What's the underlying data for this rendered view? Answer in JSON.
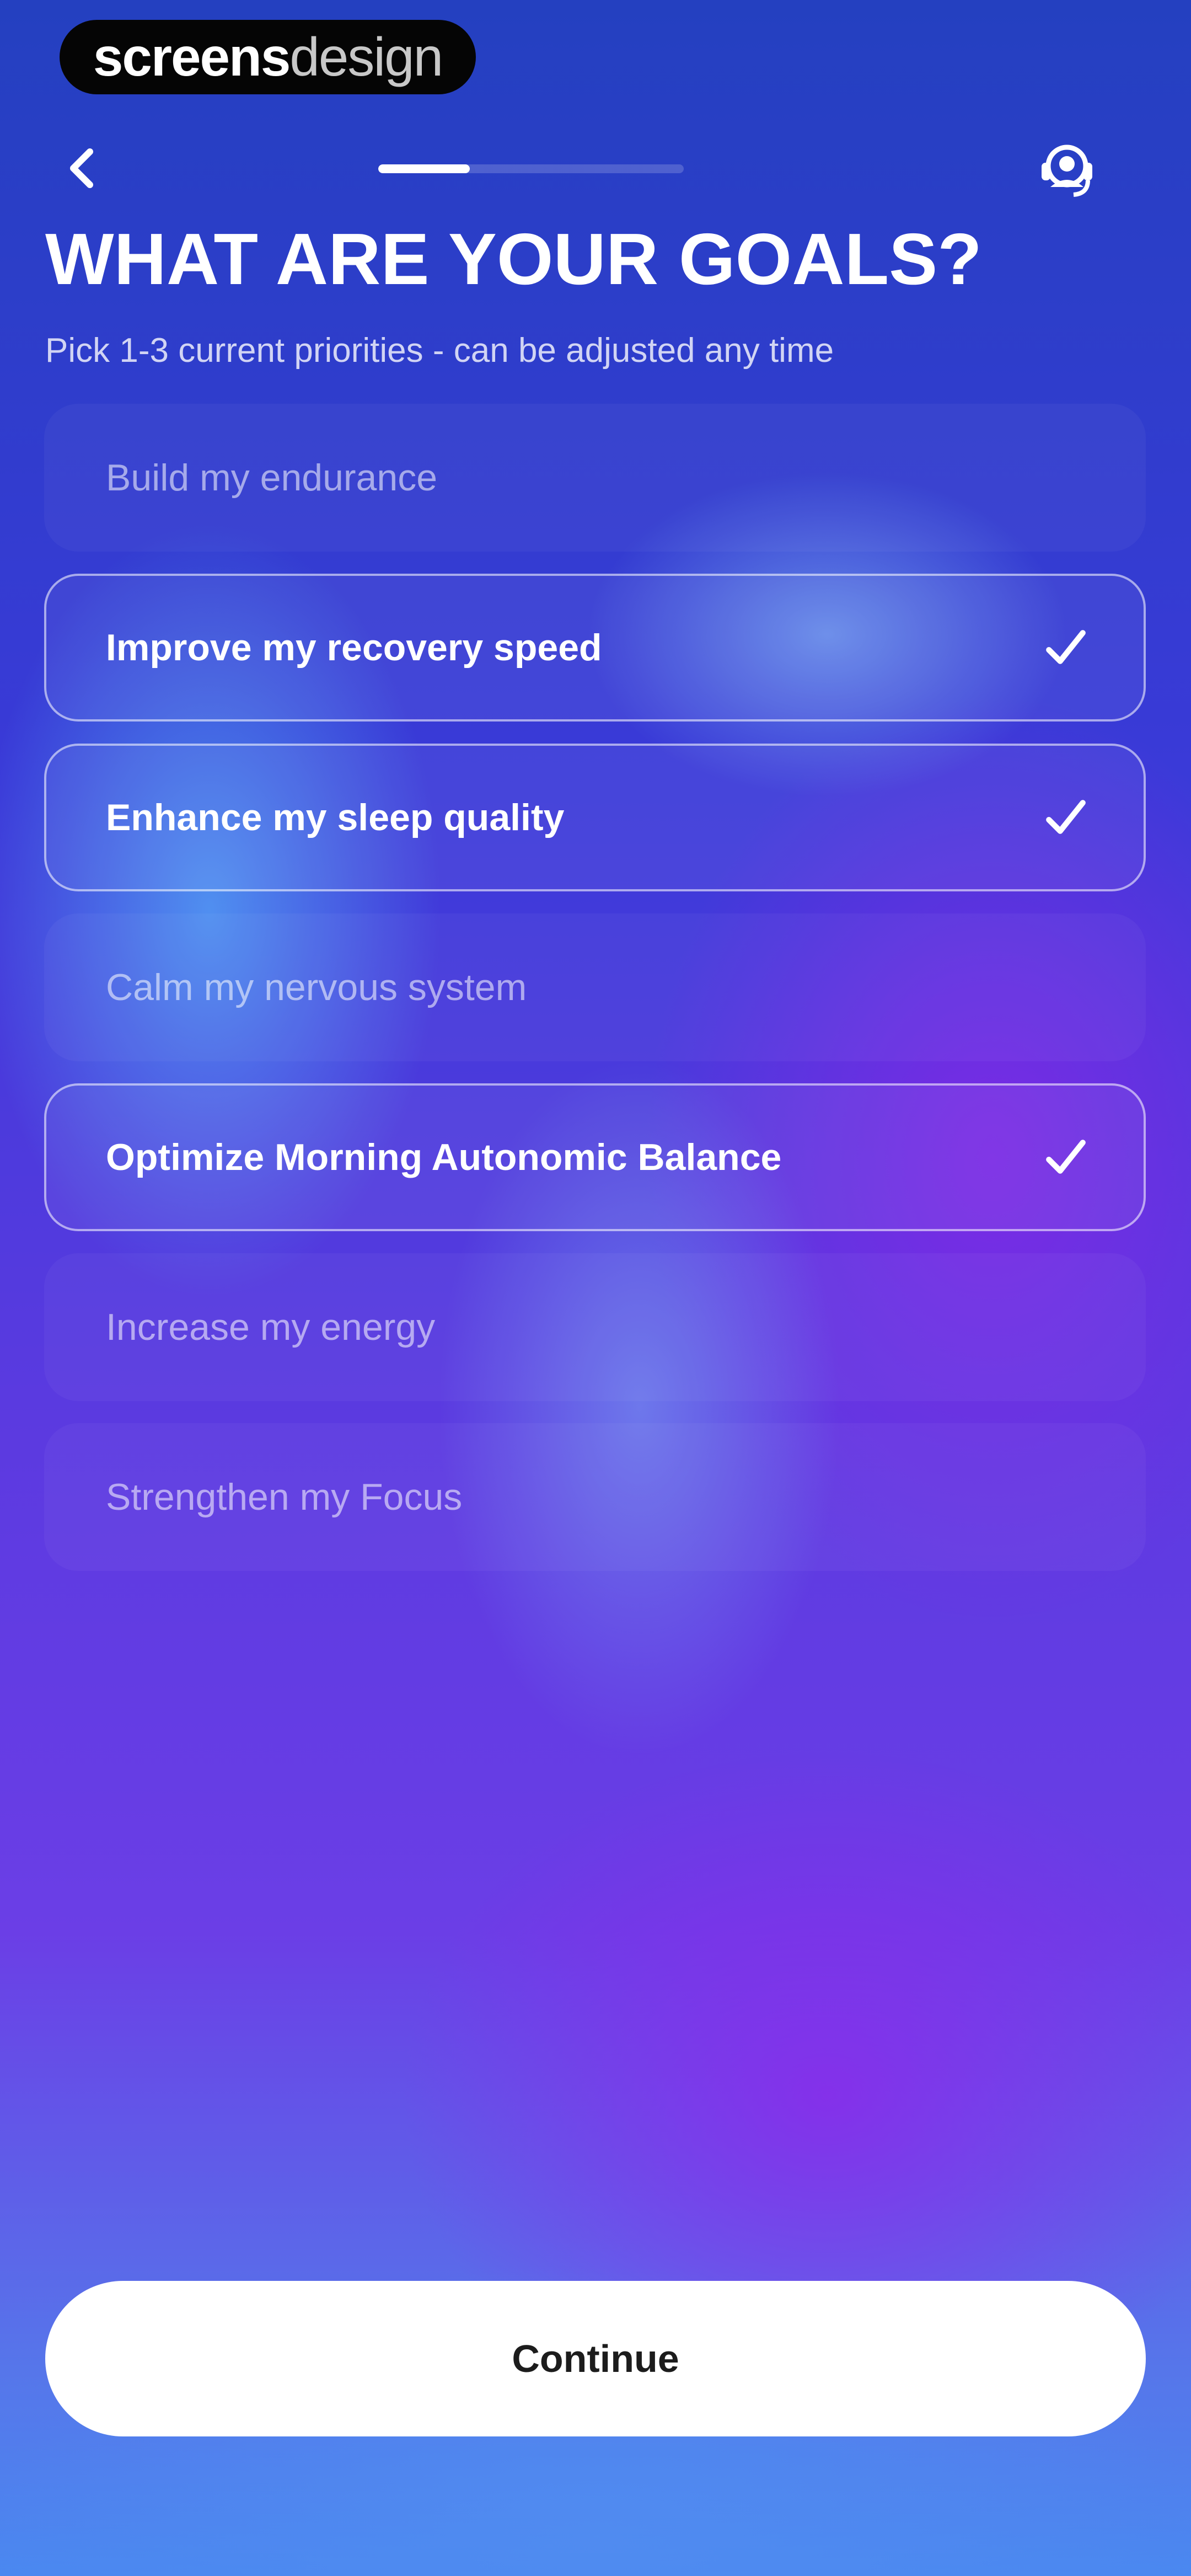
{
  "watermark": {
    "bold": "screens",
    "light": "design"
  },
  "header": {
    "back_icon": "chevron-left-icon",
    "support_icon": "support-agent-icon",
    "progress": 0.3
  },
  "title": "WHAT ARE YOUR GOALS?",
  "subtitle": "Pick 1-3 current priorities - can be adjusted any time",
  "goals": [
    {
      "label": "Build my endurance",
      "selected": false
    },
    {
      "label": "Improve my recovery speed",
      "selected": true
    },
    {
      "label": "Enhance my sleep quality",
      "selected": true
    },
    {
      "label": "Calm my nervous system",
      "selected": false
    },
    {
      "label": "Optimize Morning Autonomic Balance",
      "selected": true
    },
    {
      "label": "Increase my energy",
      "selected": false
    },
    {
      "label": "Strengthen my Focus",
      "selected": false
    }
  ],
  "check_icon": "checkmark-icon",
  "continue_label": "Continue",
  "colors": {
    "background_top": "#2440c0",
    "background_mid": "#6b3ee6",
    "background_bottom": "#4a88f0",
    "button_bg": "#ffffff",
    "button_text": "#1c1c1c"
  }
}
